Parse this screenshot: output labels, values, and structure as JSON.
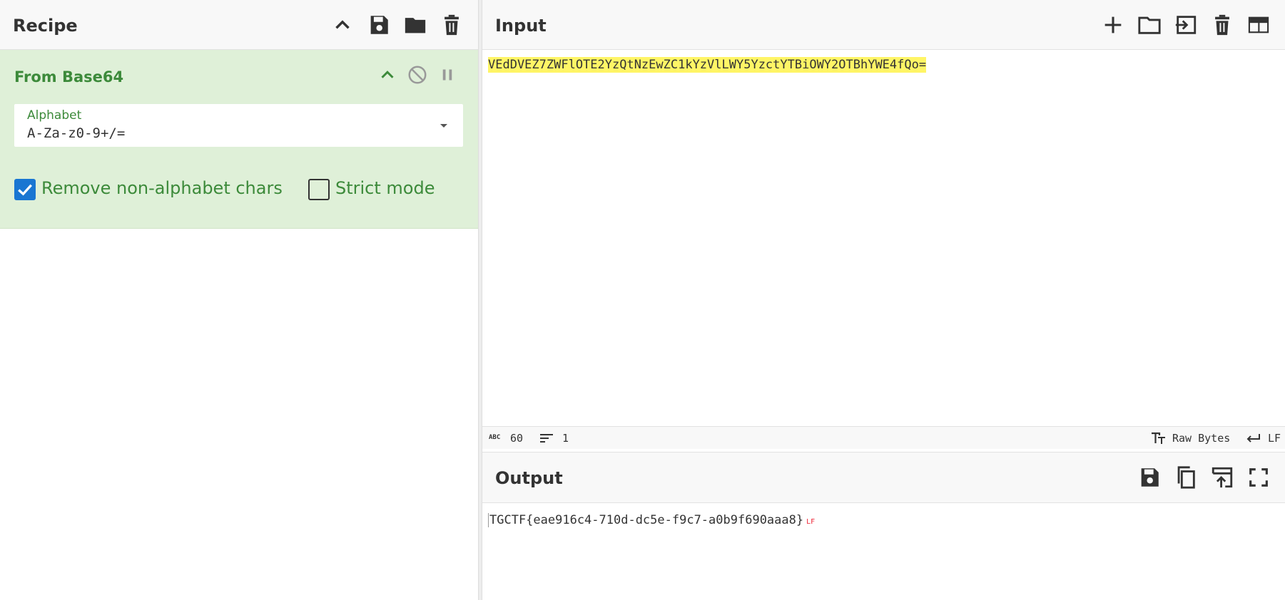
{
  "recipe": {
    "title": "Recipe",
    "operation": {
      "name": "From Base64",
      "alphabet_label": "Alphabet",
      "alphabet_value": "A-Za-z0-9+/=",
      "remove_non_alphabet_label": "Remove non-alphabet chars",
      "remove_non_alphabet_checked": true,
      "strict_mode_label": "Strict mode",
      "strict_mode_checked": false
    }
  },
  "input": {
    "title": "Input",
    "text": "VEdDVEZ7ZWFlOTE2YzQtNzEwZC1kYzVlLWY5YzctYTBiOWY2OTBhYWE4fQo=",
    "status": {
      "char_count_label": "ABC",
      "char_count": "60",
      "line_count": "1",
      "encoding": "Raw Bytes",
      "eol": "LF"
    }
  },
  "output": {
    "title": "Output",
    "text": "TGCTF{eae916c4-710d-dc5e-f9c7-a0b9f690aaa8}",
    "eol_marker": "LF"
  },
  "colors": {
    "accent_green": "#3c8a3a",
    "card_bg": "#dff0d8",
    "highlight": "#fff566",
    "checkbox_blue": "#1976d2"
  }
}
